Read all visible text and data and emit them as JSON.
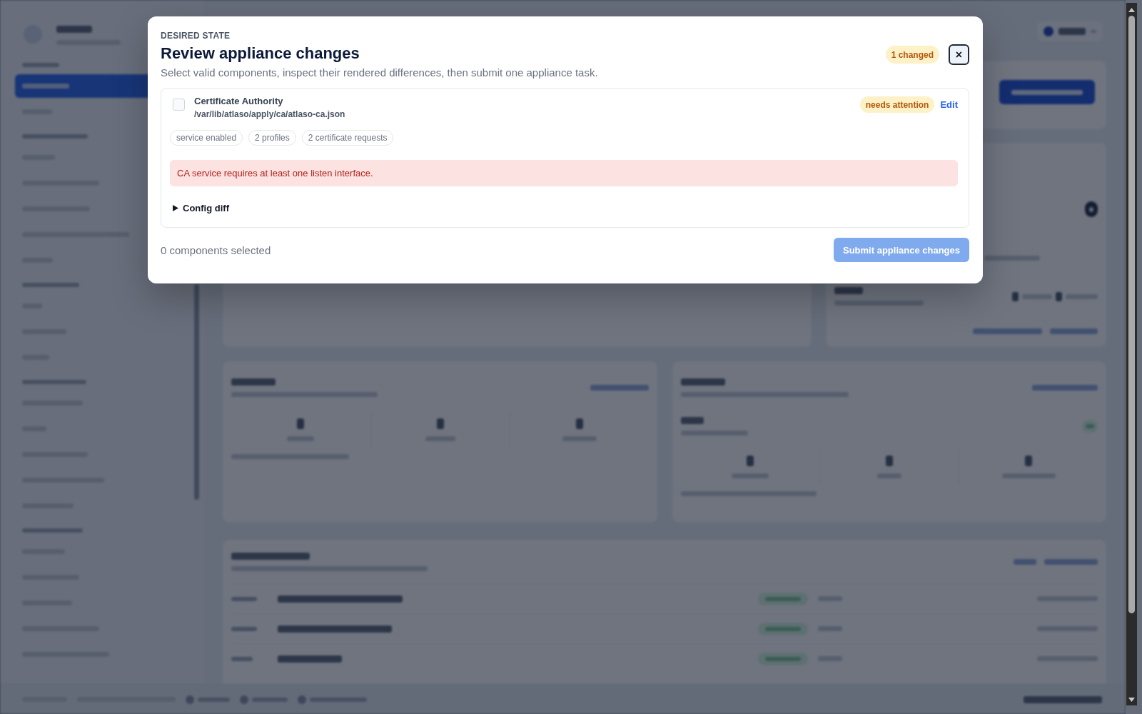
{
  "modal": {
    "eyebrow": "DESIRED STATE",
    "title": "Review appliance changes",
    "description": "Select valid components, inspect their rendered differences, then submit one appliance task.",
    "badge": "1 changed",
    "close": "×",
    "components": [
      {
        "name": "Certificate Authority",
        "path": "/var/lib/atlaso/apply/ca/atlaso-ca.json",
        "checked": false,
        "status": "needs attention",
        "action": "Edit",
        "chips": [
          "service enabled",
          "2 profiles",
          "2 certificate requests"
        ],
        "error": "CA service requires at least one listen interface.",
        "diff_label": "Config diff",
        "expanded": false
      }
    ],
    "selection_summary": "0 components selected",
    "submit": {
      "label": "Submit appliance changes",
      "disabled": true
    }
  }
}
